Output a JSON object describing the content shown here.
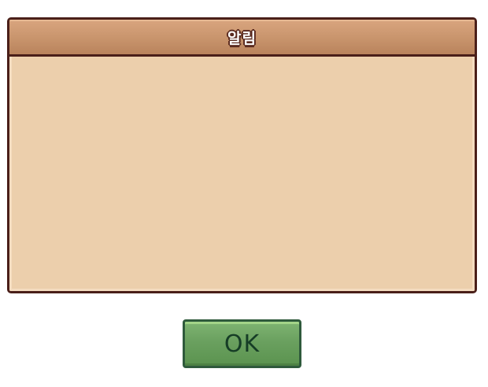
{
  "dialog": {
    "title": "알림",
    "message": ""
  },
  "buttons": {
    "ok_label": "OK"
  },
  "colors": {
    "panel_background": "#eccfac",
    "title_bar": "#c8946c",
    "border": "#4a1f19",
    "ok_button": "#6aa05f",
    "ok_text": "#163d26"
  }
}
